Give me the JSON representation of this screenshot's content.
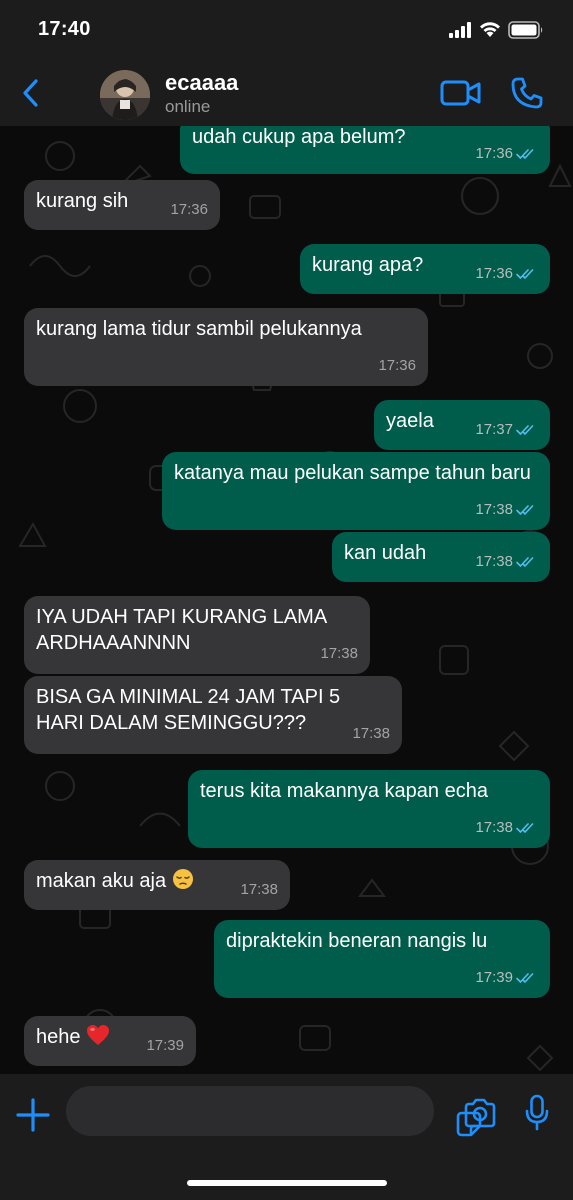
{
  "status_bar": {
    "time": "17:40"
  },
  "header": {
    "contact_name": "ecaaaa",
    "presence": "online"
  },
  "messages": [
    {
      "dir": "out",
      "text": "udah cukup apa belum?",
      "time": "17:36",
      "read": true
    },
    {
      "dir": "in",
      "text": "kurang sih",
      "time": "17:36"
    },
    {
      "dir": "out",
      "text": "kurang apa?",
      "time": "17:36",
      "read": true
    },
    {
      "dir": "in",
      "text": "kurang lama tidur sambil pelukannya",
      "time": "17:36"
    },
    {
      "dir": "out",
      "text": "yaela",
      "time": "17:37",
      "read": true
    },
    {
      "dir": "out",
      "text": "katanya mau pelukan sampe tahun baru",
      "time": "17:38",
      "read": true
    },
    {
      "dir": "out",
      "text": "kan udah",
      "time": "17:38",
      "read": true
    },
    {
      "dir": "in",
      "text": "IYA UDAH TAPI KURANG LAMA ARDHAAANNNN",
      "time": "17:38"
    },
    {
      "dir": "in",
      "text": "BISA GA MINIMAL 24 JAM TAPI 5 HARI DALAM SEMINGGU???",
      "time": "17:38"
    },
    {
      "dir": "out",
      "text": "terus kita makannya kapan echa",
      "time": "17:38",
      "read": true
    },
    {
      "dir": "in",
      "text": "makan aku aja",
      "emoji": "pensive-face",
      "time": "17:38"
    },
    {
      "dir": "out",
      "text": "dipraktekin beneran nangis lu",
      "time": "17:39",
      "read": true
    },
    {
      "dir": "in",
      "text": "hehe",
      "emoji": "red-heart",
      "time": "17:39"
    }
  ],
  "colors": {
    "accent": "#1e8efb",
    "incoming_bubble": "#363638",
    "outgoing_bubble": "#005c4b",
    "read_ticks": "#53bdeb",
    "background": "#0b0b0b",
    "bar": "#1c1c1d"
  },
  "icons": {
    "header": [
      "back-chevron-icon",
      "video-call-icon",
      "phone-call-icon"
    ],
    "input_bar": [
      "plus-icon",
      "sticker-icon",
      "camera-icon",
      "microphone-icon"
    ]
  }
}
